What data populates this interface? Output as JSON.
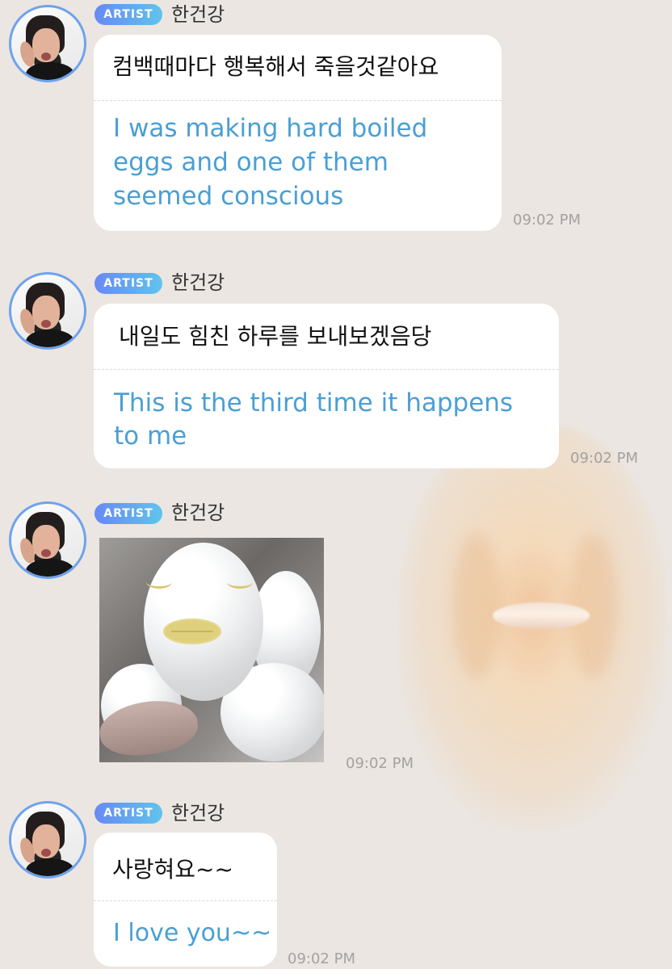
{
  "chat": {
    "messages": [
      {
        "badge": "ARTIST",
        "name": "한건강",
        "korean": "컴백때마다 행복해서 죽을것같아요",
        "translation": [
          "I was making hard boiled",
          "eggs and one of them",
          "seemed conscious"
        ],
        "time": "09:02 PM"
      },
      {
        "badge": "ARTIST",
        "name": "한건강",
        "korean": "내일도 힘친 하루를 보내보겠음당",
        "translation": [
          "This is the third time it happens",
          "to me"
        ],
        "time": "09:02 PM"
      },
      {
        "badge": "ARTIST",
        "name": "한건강",
        "image": "egg-face-photo",
        "time": "09:02 PM"
      },
      {
        "badge": "ARTIST",
        "name": "한건강",
        "korean": "사랑혀요~~",
        "translation": [
          "I love you~~"
        ],
        "time": "09:02 PM"
      }
    ]
  },
  "icons": {
    "avatar": "profile-avatar-icon",
    "overlay": "blurred-face-overlay"
  },
  "colors": {
    "background": "#ebe6e1",
    "bubble": "#ffffff",
    "translation": "#4a9fd4",
    "timestamp": "#a4a1a0",
    "badge_start": "#6789f5",
    "badge_end": "#5fc4ec",
    "avatar_ring": "#6ea2ee"
  }
}
